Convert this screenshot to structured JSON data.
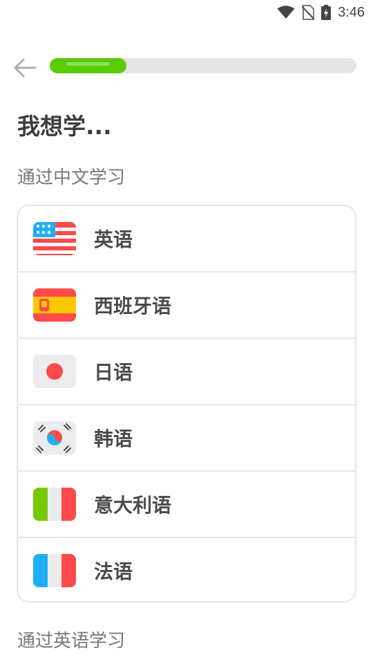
{
  "status_bar": {
    "time": "3:46",
    "icons": [
      "wifi-icon",
      "no-sim-icon",
      "battery-charging-icon"
    ]
  },
  "header": {
    "back_icon": "arrow-left-icon",
    "progress": 0.25,
    "progress_color": "#58cc02"
  },
  "page": {
    "title": "我想学..."
  },
  "sections": [
    {
      "header": "通过中文学习",
      "languages": [
        {
          "label": "英语",
          "flag": "us-flag-icon"
        },
        {
          "label": "西班牙语",
          "flag": "spain-flag-icon"
        },
        {
          "label": "日语",
          "flag": "japan-flag-icon"
        },
        {
          "label": "韩语",
          "flag": "korea-flag-icon"
        },
        {
          "label": "意大利语",
          "flag": "italy-flag-icon"
        },
        {
          "label": "法语",
          "flag": "france-flag-icon"
        }
      ]
    },
    {
      "header": "通过英语学习",
      "languages": []
    }
  ]
}
